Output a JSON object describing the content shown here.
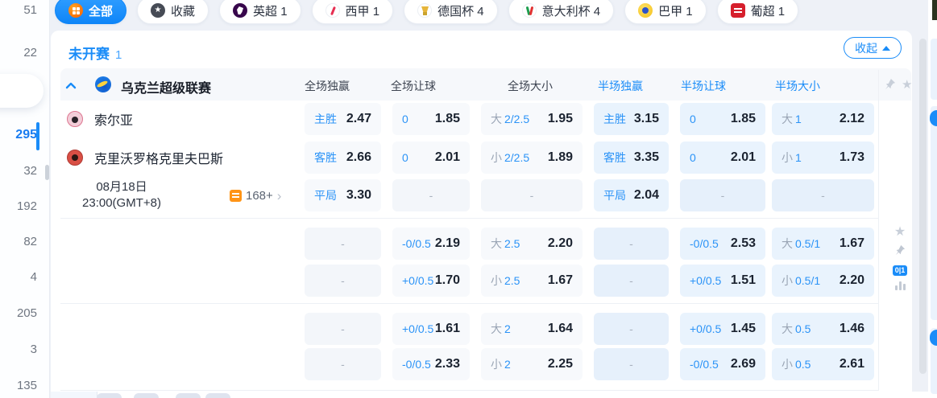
{
  "colors": {
    "accent": "#1a8cf8",
    "odds_text": "#1b2330",
    "half_cell_bg": "#e9f3fd",
    "full_cell_bg": "#f7f9fc",
    "tab_active_bg": "#1b8ffa",
    "all_icon_orange": "#f85c00"
  },
  "sidebar": {
    "items": [
      {
        "count": "51",
        "active": false
      },
      {
        "count": "22",
        "active": false
      },
      {
        "count": "295",
        "active": true
      },
      {
        "count": "32",
        "active": false
      },
      {
        "count": "192",
        "active": false
      },
      {
        "count": "82",
        "active": false
      },
      {
        "count": "4",
        "active": false
      },
      {
        "count": "205",
        "active": false
      },
      {
        "count": "3",
        "active": false
      },
      {
        "count": "135",
        "active": false
      }
    ]
  },
  "tabs": [
    {
      "label": "全部",
      "count": "",
      "icon": "all",
      "active": true
    },
    {
      "label": "收藏",
      "count": "",
      "icon": "fav",
      "active": false
    },
    {
      "label": "英超",
      "count": "1",
      "icon": "pl",
      "active": false
    },
    {
      "label": "西甲",
      "count": "1",
      "icon": "laliga",
      "active": false
    },
    {
      "label": "德国杯",
      "count": "4",
      "icon": "dfb",
      "active": false
    },
    {
      "label": "意大利杯",
      "count": "4",
      "icon": "coppa",
      "active": false
    },
    {
      "label": "巴甲",
      "count": "1",
      "icon": "bra",
      "active": false
    },
    {
      "label": "葡超",
      "count": "1",
      "icon": "por",
      "active": false
    }
  ],
  "panel": {
    "status_label": "未开赛",
    "status_count": "1",
    "collapse_label": "收起",
    "league_name": "乌克兰超级联赛",
    "columns": [
      {
        "label": "全场独赢",
        "half": false
      },
      {
        "label": "全场让球",
        "half": false
      },
      {
        "label": "全场大小",
        "half": false
      },
      {
        "label": "半场独赢",
        "half": true
      },
      {
        "label": "半场让球",
        "half": true
      },
      {
        "label": "半场大小",
        "half": true
      }
    ],
    "match": {
      "home_team": "索尔亚",
      "away_team": "克里沃罗格克里夫巴斯",
      "date": "08月18日",
      "time": "23:00(GMT+8)",
      "markets_count": "168+",
      "markets_chevron": "›",
      "action_badge": "0|1"
    },
    "dash_char": "-",
    "rows": [
      {
        "cells": [
          {
            "lab": "主胜",
            "odds": "2.47"
          },
          {
            "lab": "0",
            "odds": "1.85"
          },
          {
            "pre": "大",
            "lab": "2/2.5",
            "odds": "1.95"
          },
          {
            "lab": "主胜",
            "odds": "3.15"
          },
          {
            "lab": "0",
            "odds": "1.85"
          },
          {
            "pre": "大",
            "lab": "1",
            "odds": "2.12"
          }
        ]
      },
      {
        "cells": [
          {
            "lab": "客胜",
            "odds": "2.66"
          },
          {
            "lab": "0",
            "odds": "2.01"
          },
          {
            "pre": "小",
            "lab": "2/2.5",
            "odds": "1.89"
          },
          {
            "lab": "客胜",
            "odds": "3.35"
          },
          {
            "lab": "0",
            "odds": "2.01"
          },
          {
            "pre": "小",
            "lab": "1",
            "odds": "1.73"
          }
        ]
      },
      {
        "cells": [
          {
            "lab": "平局",
            "odds": "3.30"
          },
          {
            "dash": true
          },
          {
            "dash": true
          },
          {
            "lab": "平局",
            "odds": "2.04"
          },
          {
            "dash": true
          },
          {
            "dash": true
          }
        ]
      },
      {
        "cells": [
          {
            "dash": true
          },
          {
            "lab": "-0/0.5",
            "odds": "2.19"
          },
          {
            "pre": "大",
            "lab": "2.5",
            "odds": "2.20"
          },
          {
            "dash": true
          },
          {
            "lab": "-0/0.5",
            "odds": "2.53"
          },
          {
            "pre": "大",
            "lab": "0.5/1",
            "odds": "1.67"
          }
        ]
      },
      {
        "cells": [
          {
            "dash": true
          },
          {
            "lab": "+0/0.5",
            "odds": "1.70"
          },
          {
            "pre": "小",
            "lab": "2.5",
            "odds": "1.67"
          },
          {
            "dash": true
          },
          {
            "lab": "+0/0.5",
            "odds": "1.51"
          },
          {
            "pre": "小",
            "lab": "0.5/1",
            "odds": "2.20"
          }
        ]
      },
      {
        "cells": [
          {
            "dash": true
          },
          {
            "lab": "+0/0.5",
            "odds": "1.61"
          },
          {
            "pre": "大",
            "lab": "2",
            "odds": "1.64"
          },
          {
            "dash": true
          },
          {
            "lab": "+0/0.5",
            "odds": "1.45"
          },
          {
            "pre": "大",
            "lab": "0.5",
            "odds": "1.46"
          }
        ]
      },
      {
        "cells": [
          {
            "dash": true
          },
          {
            "lab": "-0/0.5",
            "odds": "2.33"
          },
          {
            "pre": "小",
            "lab": "2",
            "odds": "2.25"
          },
          {
            "dash": true
          },
          {
            "lab": "-0/0.5",
            "odds": "2.69"
          },
          {
            "pre": "小",
            "lab": "0.5",
            "odds": "2.61"
          }
        ]
      }
    ]
  }
}
